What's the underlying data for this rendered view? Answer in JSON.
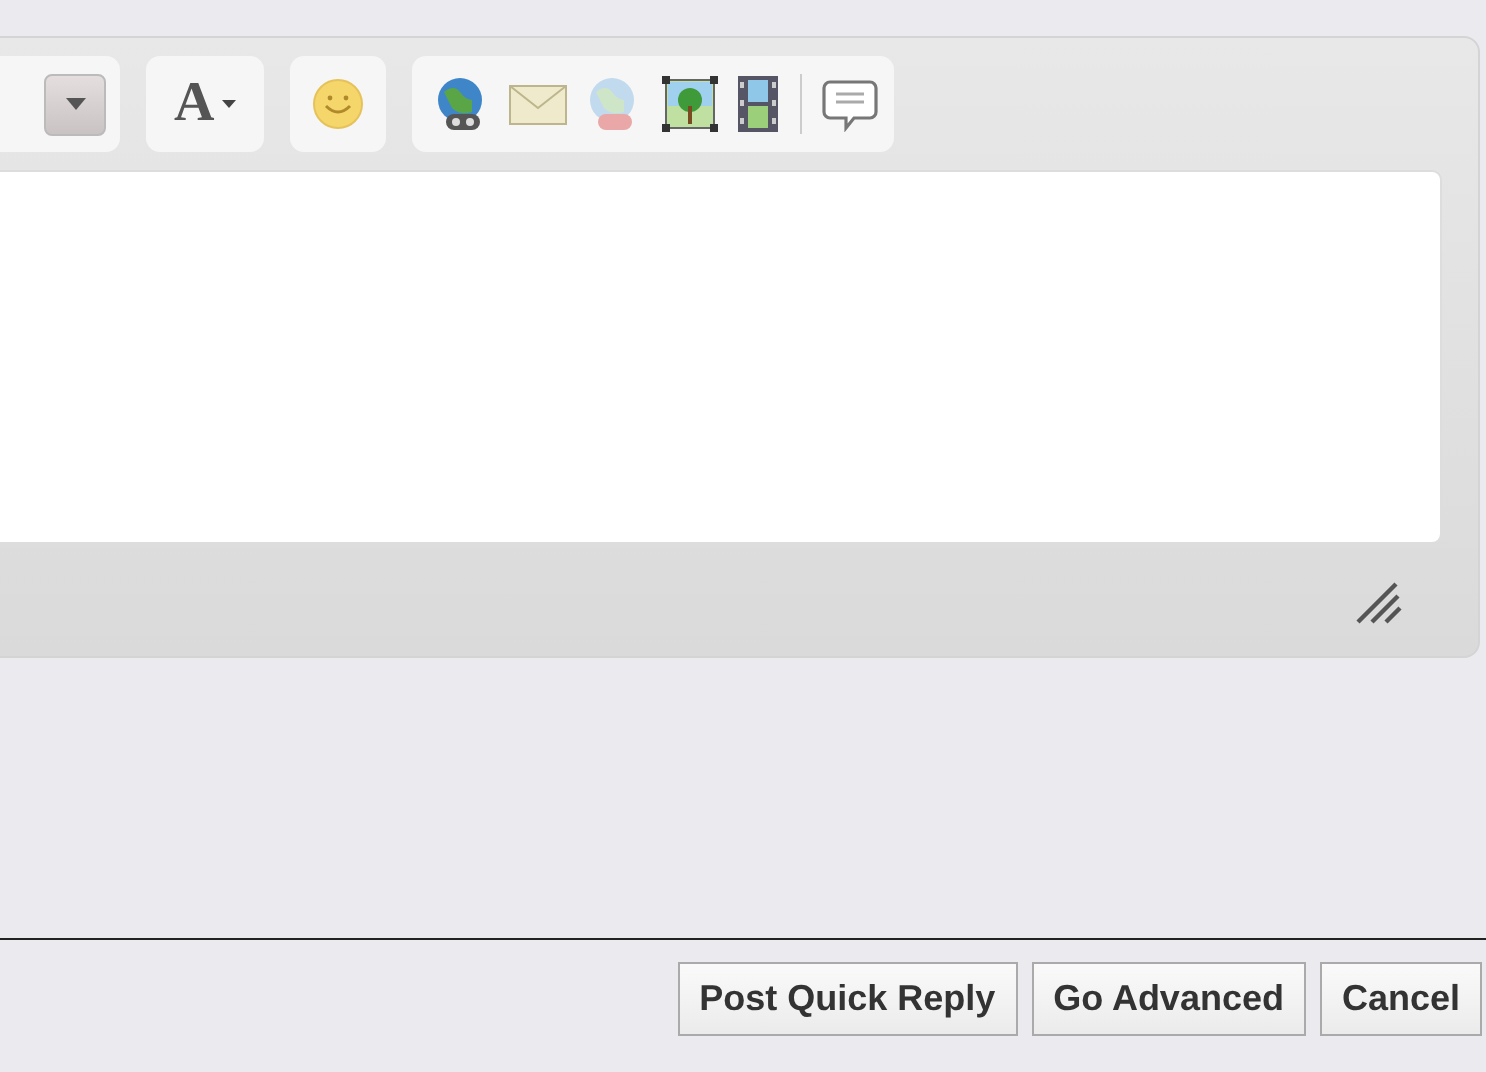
{
  "toolbar": {
    "font_color_button": {
      "label": "A"
    }
  },
  "buttons": [
    {
      "label": "Post Quick Reply"
    },
    {
      "label": "Go Advanced"
    },
    {
      "label": "Cancel"
    }
  ]
}
